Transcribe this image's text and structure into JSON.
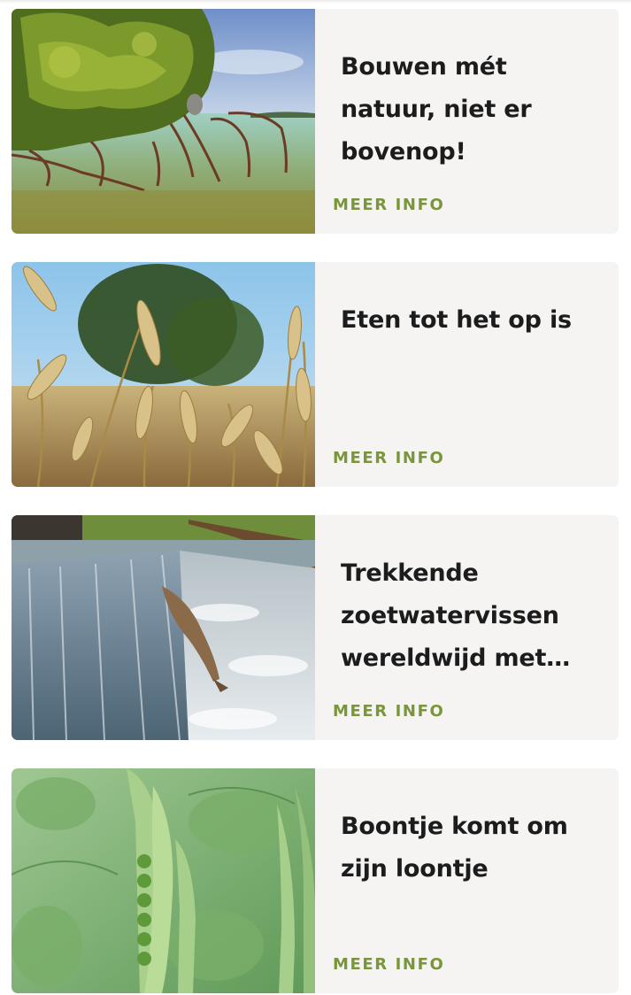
{
  "cards": [
    {
      "title": "Bouwen mét natuur, niet er bovenop!",
      "more_label": "MEER INFO",
      "image": "mangrove-coast-photo"
    },
    {
      "title": "Eten tot het op is",
      "more_label": "MEER INFO",
      "image": "wheat-field-photo"
    },
    {
      "title": "Trekkende zoetwatervissen wereldwijd met m…",
      "more_label": "MEER INFO",
      "image": "salmon-waterfall-photo"
    },
    {
      "title": "Boontje komt om zijn loontje",
      "more_label": "MEER INFO",
      "image": "pea-pods-photo"
    }
  ],
  "colors": {
    "accent": "#7a963a",
    "card_bg": "#f5f4f2",
    "title": "#1c1c1c"
  }
}
